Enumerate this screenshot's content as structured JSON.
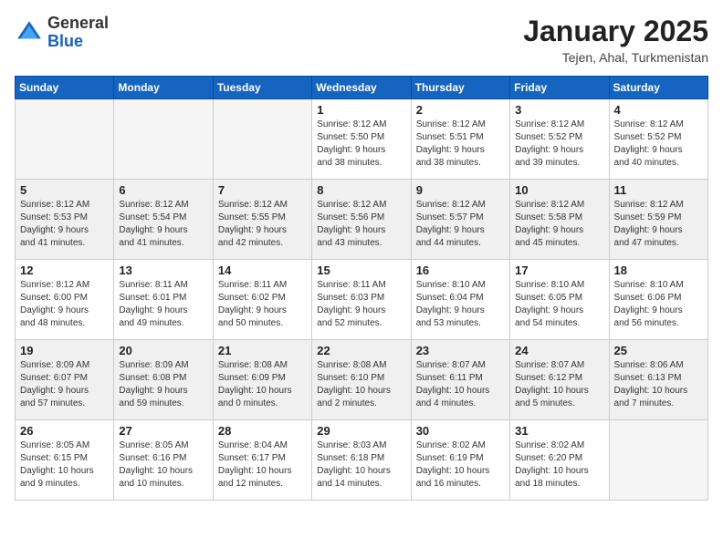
{
  "logo": {
    "general": "General",
    "blue": "Blue"
  },
  "header": {
    "title": "January 2025",
    "subtitle": "Tejen, Ahal, Turkmenistan"
  },
  "weekdays": [
    "Sunday",
    "Monday",
    "Tuesday",
    "Wednesday",
    "Thursday",
    "Friday",
    "Saturday"
  ],
  "weeks": [
    {
      "shaded": false,
      "days": [
        {
          "num": "",
          "info": ""
        },
        {
          "num": "",
          "info": ""
        },
        {
          "num": "",
          "info": ""
        },
        {
          "num": "1",
          "info": "Sunrise: 8:12 AM\nSunset: 5:50 PM\nDaylight: 9 hours\nand 38 minutes."
        },
        {
          "num": "2",
          "info": "Sunrise: 8:12 AM\nSunset: 5:51 PM\nDaylight: 9 hours\nand 38 minutes."
        },
        {
          "num": "3",
          "info": "Sunrise: 8:12 AM\nSunset: 5:52 PM\nDaylight: 9 hours\nand 39 minutes."
        },
        {
          "num": "4",
          "info": "Sunrise: 8:12 AM\nSunset: 5:52 PM\nDaylight: 9 hours\nand 40 minutes."
        }
      ]
    },
    {
      "shaded": true,
      "days": [
        {
          "num": "5",
          "info": "Sunrise: 8:12 AM\nSunset: 5:53 PM\nDaylight: 9 hours\nand 41 minutes."
        },
        {
          "num": "6",
          "info": "Sunrise: 8:12 AM\nSunset: 5:54 PM\nDaylight: 9 hours\nand 41 minutes."
        },
        {
          "num": "7",
          "info": "Sunrise: 8:12 AM\nSunset: 5:55 PM\nDaylight: 9 hours\nand 42 minutes."
        },
        {
          "num": "8",
          "info": "Sunrise: 8:12 AM\nSunset: 5:56 PM\nDaylight: 9 hours\nand 43 minutes."
        },
        {
          "num": "9",
          "info": "Sunrise: 8:12 AM\nSunset: 5:57 PM\nDaylight: 9 hours\nand 44 minutes."
        },
        {
          "num": "10",
          "info": "Sunrise: 8:12 AM\nSunset: 5:58 PM\nDaylight: 9 hours\nand 45 minutes."
        },
        {
          "num": "11",
          "info": "Sunrise: 8:12 AM\nSunset: 5:59 PM\nDaylight: 9 hours\nand 47 minutes."
        }
      ]
    },
    {
      "shaded": false,
      "days": [
        {
          "num": "12",
          "info": "Sunrise: 8:12 AM\nSunset: 6:00 PM\nDaylight: 9 hours\nand 48 minutes."
        },
        {
          "num": "13",
          "info": "Sunrise: 8:11 AM\nSunset: 6:01 PM\nDaylight: 9 hours\nand 49 minutes."
        },
        {
          "num": "14",
          "info": "Sunrise: 8:11 AM\nSunset: 6:02 PM\nDaylight: 9 hours\nand 50 minutes."
        },
        {
          "num": "15",
          "info": "Sunrise: 8:11 AM\nSunset: 6:03 PM\nDaylight: 9 hours\nand 52 minutes."
        },
        {
          "num": "16",
          "info": "Sunrise: 8:10 AM\nSunset: 6:04 PM\nDaylight: 9 hours\nand 53 minutes."
        },
        {
          "num": "17",
          "info": "Sunrise: 8:10 AM\nSunset: 6:05 PM\nDaylight: 9 hours\nand 54 minutes."
        },
        {
          "num": "18",
          "info": "Sunrise: 8:10 AM\nSunset: 6:06 PM\nDaylight: 9 hours\nand 56 minutes."
        }
      ]
    },
    {
      "shaded": true,
      "days": [
        {
          "num": "19",
          "info": "Sunrise: 8:09 AM\nSunset: 6:07 PM\nDaylight: 9 hours\nand 57 minutes."
        },
        {
          "num": "20",
          "info": "Sunrise: 8:09 AM\nSunset: 6:08 PM\nDaylight: 9 hours\nand 59 minutes."
        },
        {
          "num": "21",
          "info": "Sunrise: 8:08 AM\nSunset: 6:09 PM\nDaylight: 10 hours\nand 0 minutes."
        },
        {
          "num": "22",
          "info": "Sunrise: 8:08 AM\nSunset: 6:10 PM\nDaylight: 10 hours\nand 2 minutes."
        },
        {
          "num": "23",
          "info": "Sunrise: 8:07 AM\nSunset: 6:11 PM\nDaylight: 10 hours\nand 4 minutes."
        },
        {
          "num": "24",
          "info": "Sunrise: 8:07 AM\nSunset: 6:12 PM\nDaylight: 10 hours\nand 5 minutes."
        },
        {
          "num": "25",
          "info": "Sunrise: 8:06 AM\nSunset: 6:13 PM\nDaylight: 10 hours\nand 7 minutes."
        }
      ]
    },
    {
      "shaded": false,
      "days": [
        {
          "num": "26",
          "info": "Sunrise: 8:05 AM\nSunset: 6:15 PM\nDaylight: 10 hours\nand 9 minutes."
        },
        {
          "num": "27",
          "info": "Sunrise: 8:05 AM\nSunset: 6:16 PM\nDaylight: 10 hours\nand 10 minutes."
        },
        {
          "num": "28",
          "info": "Sunrise: 8:04 AM\nSunset: 6:17 PM\nDaylight: 10 hours\nand 12 minutes."
        },
        {
          "num": "29",
          "info": "Sunrise: 8:03 AM\nSunset: 6:18 PM\nDaylight: 10 hours\nand 14 minutes."
        },
        {
          "num": "30",
          "info": "Sunrise: 8:02 AM\nSunset: 6:19 PM\nDaylight: 10 hours\nand 16 minutes."
        },
        {
          "num": "31",
          "info": "Sunrise: 8:02 AM\nSunset: 6:20 PM\nDaylight: 10 hours\nand 18 minutes."
        },
        {
          "num": "",
          "info": ""
        }
      ]
    }
  ]
}
